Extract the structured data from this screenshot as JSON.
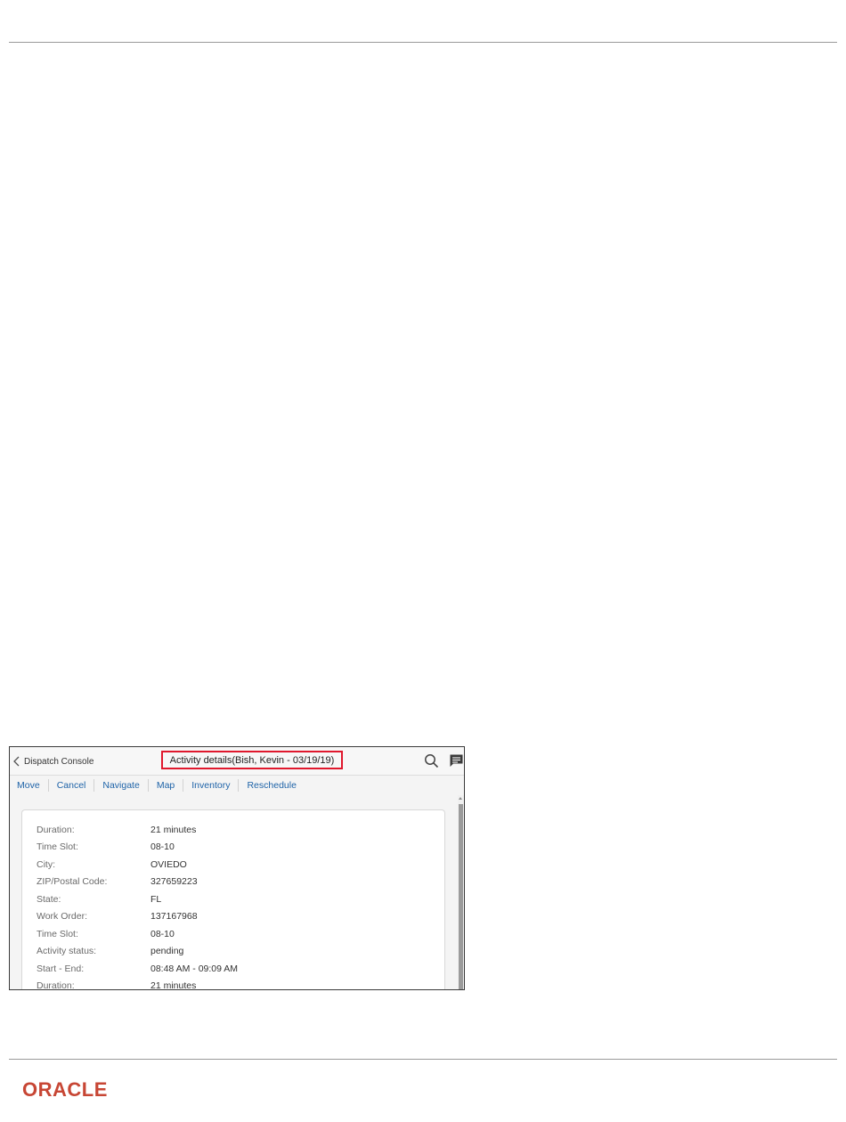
{
  "figure": {
    "header": {
      "back_label": "Dispatch Console",
      "title": "Activity details(Bish, Kevin - 03/19/19)",
      "highlight_color": "#e0182d"
    },
    "toolbar": {
      "items": [
        "Move",
        "Cancel",
        "Navigate",
        "Map",
        "Inventory",
        "Reschedule"
      ],
      "link_color": "#1e63a8"
    },
    "details": [
      {
        "label": "Duration:",
        "value": "21 minutes"
      },
      {
        "label": "Time Slot:",
        "value": "08-10"
      },
      {
        "label": "City:",
        "value": "OVIEDO"
      },
      {
        "label": "ZIP/Postal Code:",
        "value": "327659223"
      },
      {
        "label": "State:",
        "value": "FL"
      },
      {
        "label": "Work Order:",
        "value": "137167968"
      },
      {
        "label": "Time Slot:",
        "value": "08-10"
      },
      {
        "label": "Activity status:",
        "value": "pending"
      },
      {
        "label": "Start - End:",
        "value": "08:48 AM - 09:09 AM"
      },
      {
        "label": "Duration:",
        "value": "21 minutes"
      }
    ]
  },
  "footer": {
    "logo_text": "ORACLE",
    "logo_color": "#c74634"
  }
}
